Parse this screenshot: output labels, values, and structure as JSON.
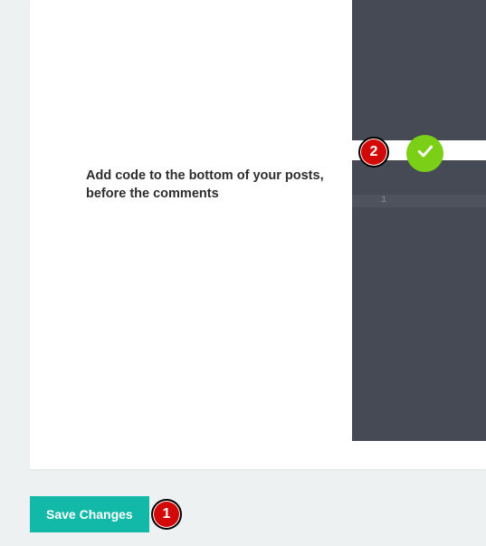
{
  "section": {
    "bottom_label": "Add code to the bottom of your posts, before the comments"
  },
  "editor": {
    "line_number": "1"
  },
  "actions": {
    "save": "Save Changes"
  },
  "markers": {
    "m1": "1",
    "m2": "2"
  },
  "icons": {
    "check": "check-icon"
  }
}
